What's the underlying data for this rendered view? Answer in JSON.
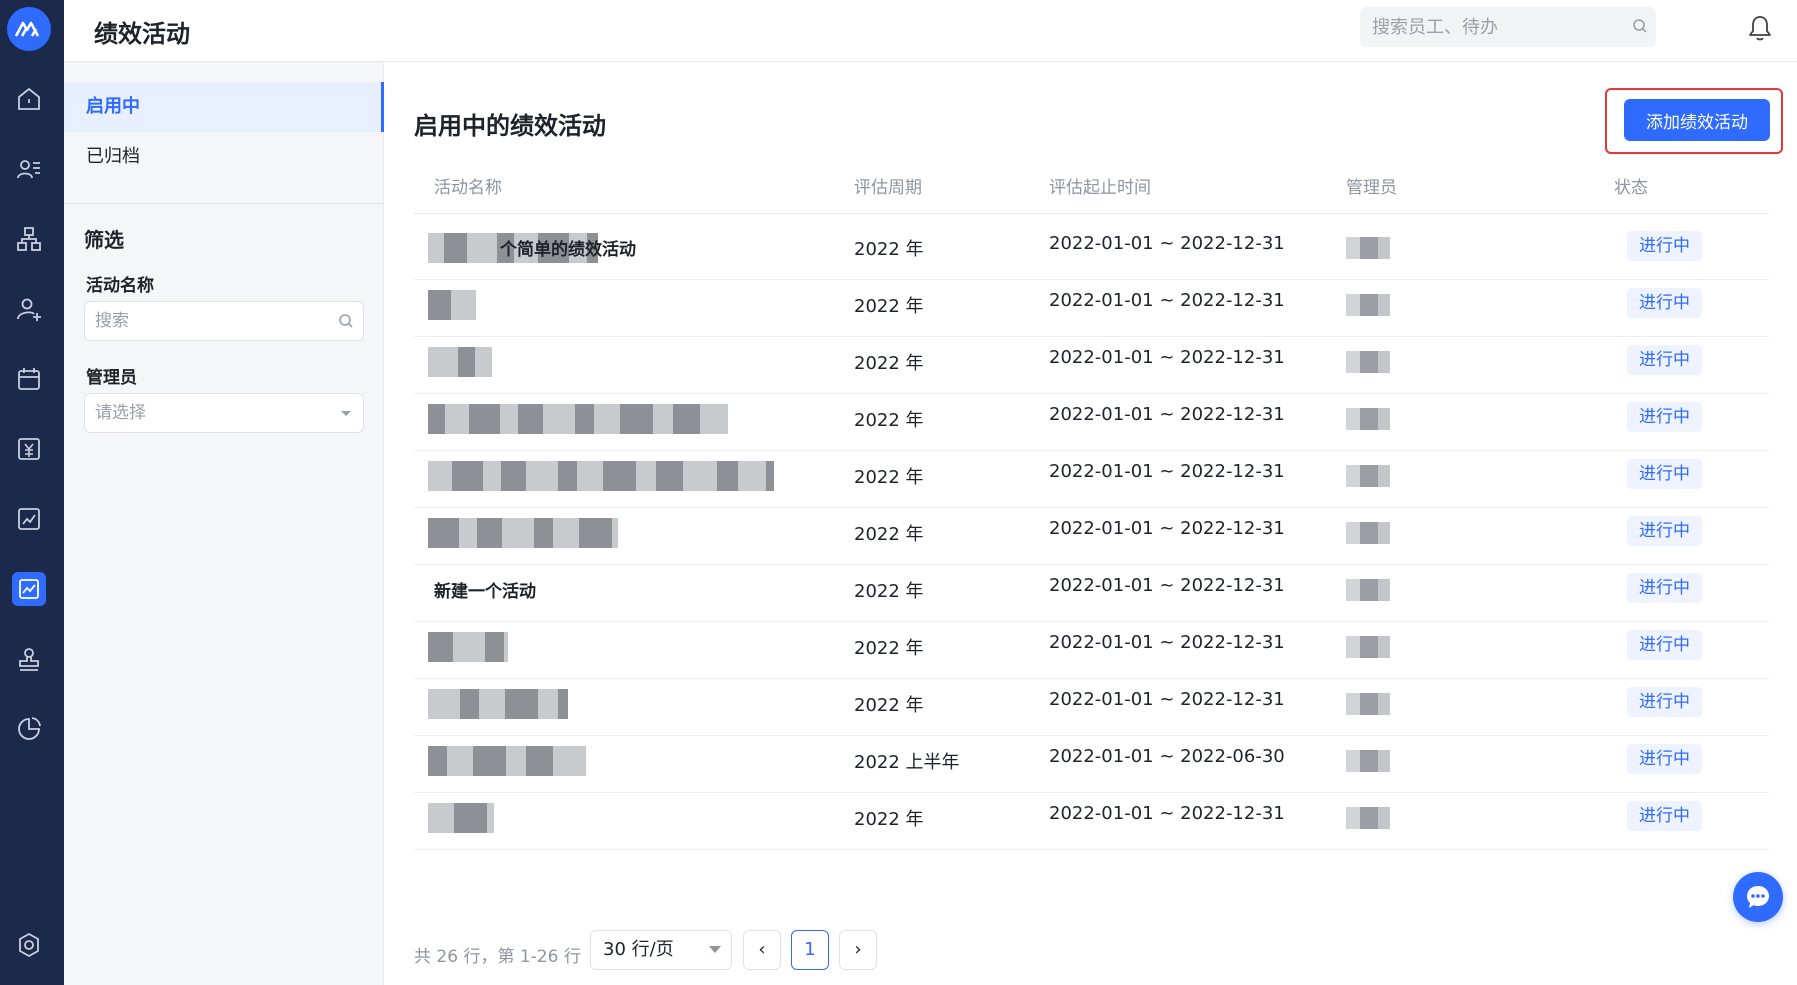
{
  "app": {
    "title": "绩效活动",
    "search_placeholder": "搜索员工、待办",
    "accent": "#2f6bff"
  },
  "rail": {
    "items": [
      {
        "icon": "home-icon"
      },
      {
        "icon": "people-list-icon"
      },
      {
        "icon": "org-chart-icon"
      },
      {
        "icon": "user-add-icon"
      },
      {
        "icon": "calendar-icon"
      },
      {
        "icon": "salary-icon"
      },
      {
        "icon": "report-icon"
      },
      {
        "icon": "performance-icon",
        "active": true
      },
      {
        "icon": "stamp-icon"
      },
      {
        "icon": "pie-chart-icon"
      },
      {
        "icon": "settings-icon"
      }
    ]
  },
  "sidebar": {
    "items": [
      {
        "label": "启用中",
        "active": true
      },
      {
        "label": "已归档",
        "active": false
      }
    ],
    "filter_heading": "筛选",
    "name_label": "活动名称",
    "name_placeholder": "搜索",
    "admin_label": "管理员",
    "admin_placeholder": "请选择"
  },
  "main": {
    "title": "启用中的绩效活动",
    "add_button": "添加绩效活动",
    "columns": [
      "活动名称",
      "评估周期",
      "评估起止时间",
      "管理员",
      "状态"
    ],
    "rows": [
      {
        "name": "个简单的绩效活动",
        "name_blurred": true,
        "period": "2022 年",
        "range": "2022-01-01 ~ 2022-12-31",
        "status": "进行中"
      },
      {
        "name": "",
        "name_blurred": true,
        "period": "2022 年",
        "range": "2022-01-01 ~ 2022-12-31",
        "status": "进行中"
      },
      {
        "name": "",
        "name_blurred": true,
        "period": "2022 年",
        "range": "2022-01-01 ~ 2022-12-31",
        "status": "进行中"
      },
      {
        "name": "",
        "name_blurred": true,
        "period": "2022 年",
        "range": "2022-01-01 ~ 2022-12-31",
        "status": "进行中"
      },
      {
        "name": "",
        "name_blurred": true,
        "period": "2022 年",
        "range": "2022-01-01 ~ 2022-12-31",
        "status": "进行中"
      },
      {
        "name": "",
        "name_blurred": true,
        "period": "2022 年",
        "range": "2022-01-01 ~ 2022-12-31",
        "status": "进行中"
      },
      {
        "name": "新建一个活动",
        "name_blurred": false,
        "period": "2022 年",
        "range": "2022-01-01 ~ 2022-12-31",
        "status": "进行中"
      },
      {
        "name": "",
        "name_blurred": true,
        "period": "2022 年",
        "range": "2022-01-01 ~ 2022-12-31",
        "status": "进行中"
      },
      {
        "name": "",
        "name_blurred": true,
        "period": "2022 年",
        "range": "2022-01-01 ~ 2022-12-31",
        "status": "进行中"
      },
      {
        "name": "",
        "name_blurred": true,
        "period": "2022 上半年",
        "range": "2022-01-01 ~ 2022-06-30",
        "status": "进行中"
      },
      {
        "name": "",
        "name_blurred": true,
        "period": "2022 年",
        "range": "2022-01-01 ~ 2022-12-31",
        "status": "进行中"
      }
    ]
  },
  "pagination": {
    "info": "共 26 行，第 1-26 行",
    "page_size": "30 行/页",
    "prev": "‹",
    "current": "1",
    "next": "›"
  }
}
